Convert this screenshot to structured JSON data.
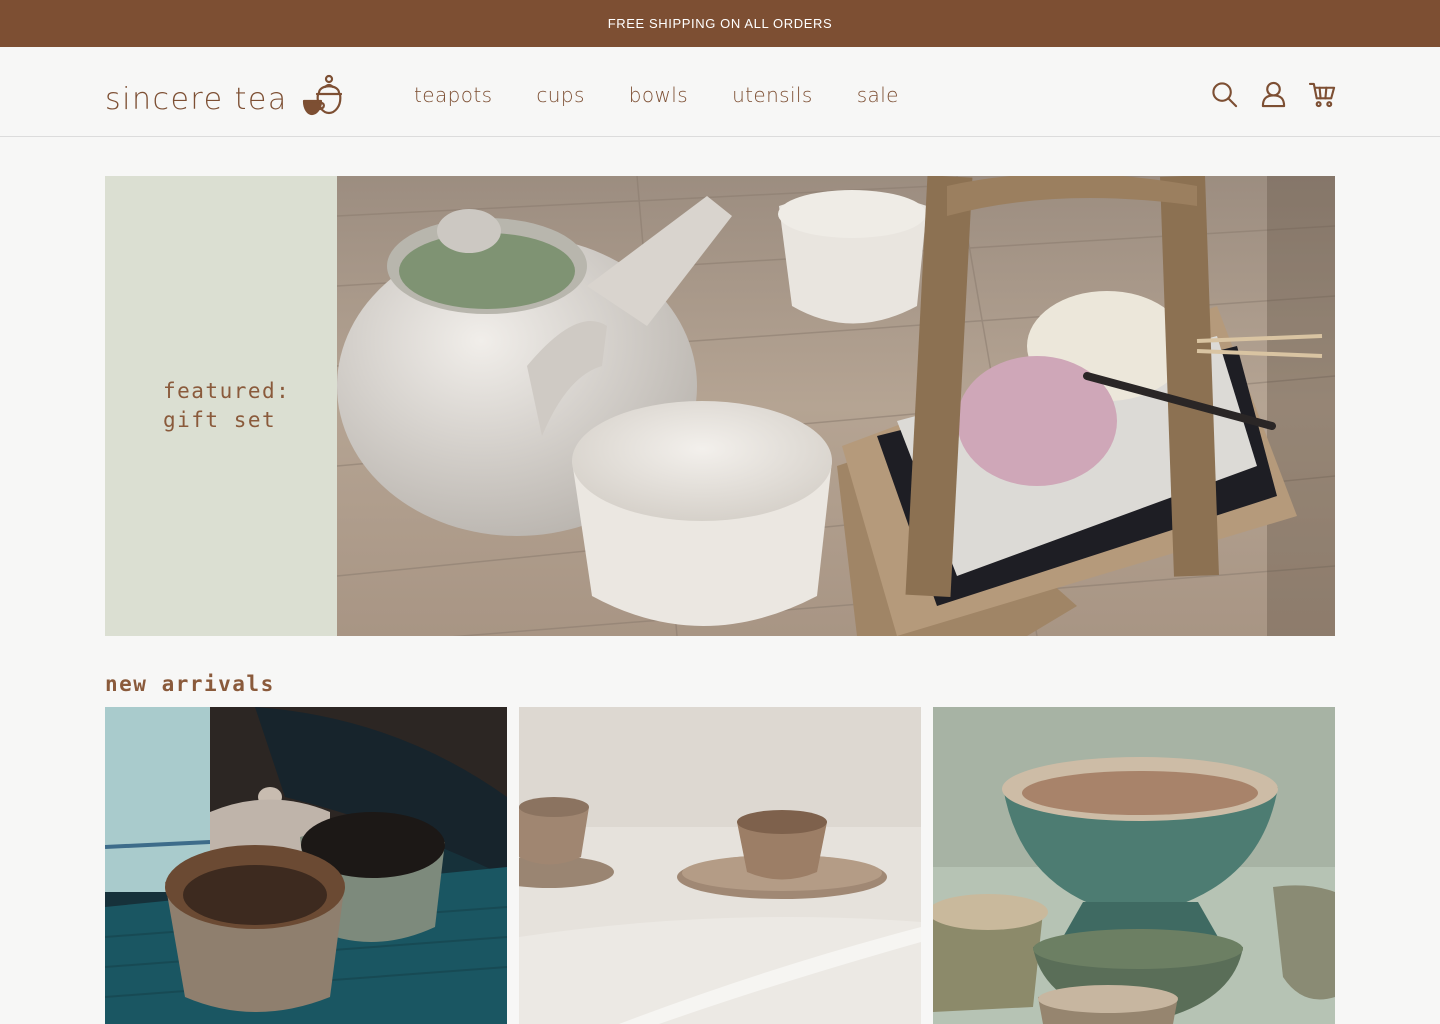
{
  "promo": {
    "text": "FREE SHIPPING ON ALL ORDERS"
  },
  "header": {
    "brand": "sincere tea",
    "logo_icon": "teapot-cup-icon",
    "nav": [
      {
        "label": "teapots"
      },
      {
        "label": "cups"
      },
      {
        "label": "bowls"
      },
      {
        "label": "utensils"
      },
      {
        "label": "sale"
      }
    ],
    "icons": [
      "search-icon",
      "account-icon",
      "cart-icon"
    ]
  },
  "hero": {
    "label_line1": "featured:",
    "label_line2": "gift set",
    "image": "teapot-cups-mochi-photo"
  },
  "new_arrivals": {
    "title": "new arrivals",
    "products": [
      {
        "image": "glazed-teal-cups-photo"
      },
      {
        "image": "earthenware-cups-saucers-photo"
      },
      {
        "image": "green-glazed-bowls-photo"
      }
    ]
  },
  "colors": {
    "brand_brown": "#7d4f33",
    "sage_panel": "#dbdfd2",
    "background": "#f7f7f6"
  }
}
